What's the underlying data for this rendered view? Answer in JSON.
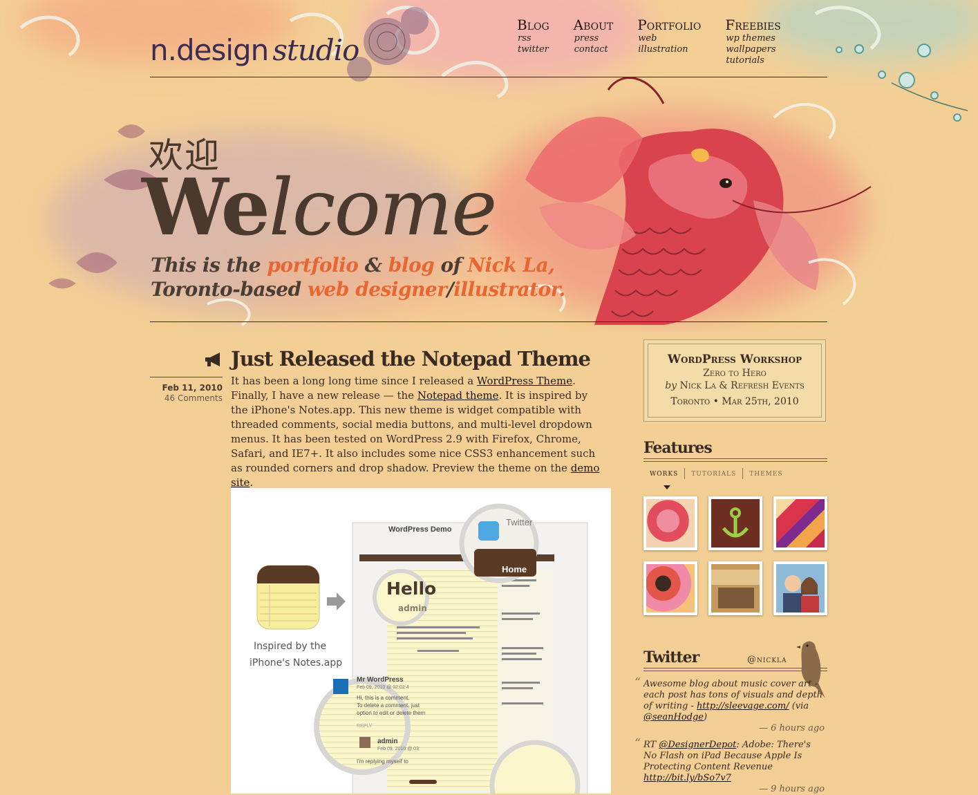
{
  "logo": {
    "main": "n.design",
    "script": "studio"
  },
  "nav": [
    {
      "title": "Blog",
      "subs": [
        "rss",
        "twitter"
      ]
    },
    {
      "title": "About",
      "subs": [
        "press",
        "contact"
      ]
    },
    {
      "title": "Portfolio",
      "subs": [
        "web",
        "illustration"
      ]
    },
    {
      "title": "Freebies",
      "subs": [
        "wp themes",
        "wallpapers",
        "tutorials"
      ]
    }
  ],
  "hero": {
    "cn": "欢迎",
    "welcome_a": "We",
    "welcome_b": "l",
    "welcome_c": "come",
    "line1": {
      "a": "This is the ",
      "b": "portfolio",
      "c": " & ",
      "d": "blog",
      "e": " of ",
      "f": "Nick La,"
    },
    "line2": {
      "a": "Toronto-based ",
      "b": "web designer",
      "c": "/",
      "d": "illustrator."
    }
  },
  "post": {
    "title": "Just Released the Notepad Theme",
    "date": "Feb 11, 2010",
    "comments": "46 Comments",
    "body": {
      "t1": "It has been a long long time since I released a ",
      "l1": "WordPress Theme",
      "t2": ". Finally, I have a new release — the ",
      "l2": "Notepad theme",
      "t3": ". It is inspired by the iPhone's Notes.app. This new theme is widget compatible with threaded comments, social media buttons, and multi-level dropdown menus. It has been tested on WordPress 2.9 with Firefox, Chrome, Safari, and IE7+. It also includes some nice CSS3 enhancement such as rounded corners and drop shadow. Preview the theme on the ",
      "l3": "demo site",
      "t4": "."
    },
    "image": {
      "caption1": "Inspired by the",
      "caption2": "iPhone's Notes.app",
      "demo_title": "WordPress Demo",
      "hello": "Hello",
      "admin": "admin",
      "twitter": "Twitter",
      "home": "Home",
      "mr_wordpress": "Mr WordPress",
      "c_date": "Feb 09, 2010 @ 02:02:4",
      "c_text1": "Hi, this is a comment.",
      "c_text2": "To delete a comment, just",
      "c_text3": "option to edit or delete them",
      "reply": "REPLY",
      "admin2": "admin",
      "c_date2": "Feb 09, 2010 @ 03",
      "c_text4": "I'm replying myself to"
    }
  },
  "workshop": {
    "title": "WordPress Workshop",
    "subtitle": "Zero to Hero",
    "by": "by",
    "authors": "Nick La & Refresh Events",
    "city": "Toronto",
    "dot": "•",
    "date": "Mar 25th, 2010"
  },
  "features": {
    "heading": "Features",
    "tabs": [
      "works",
      "tutorials",
      "themes"
    ]
  },
  "twitter": {
    "heading": "Twitter",
    "handle": "@nickla",
    "tweets": [
      {
        "t1": "Awesome blog about music cover art - each post has tons of visuals and depth of writing - ",
        "l1": "http://sleevage.com/",
        "t2": " (via ",
        "l2": "@seanHodge",
        "t3": ")",
        "time": "— 6 hours ago"
      },
      {
        "t1": "RT ",
        "l1": "@DesignerDepot",
        "t2": ": Adobe: There's No Flash on iPad Because Apple Is Protecting Content Revenue ",
        "l2": "http://bit.ly/bSo7v7",
        "t3": "",
        "time": "— 9 hours ago"
      }
    ]
  },
  "colors": {
    "accent": "#e76631",
    "background": "#f3cf95",
    "text": "#3a2b22"
  },
  "icons": [
    "megaphone-icon",
    "notes-app-icon",
    "arrow-right-icon",
    "twitter-bird-icon",
    "lock-icon",
    "bird-illustration"
  ]
}
